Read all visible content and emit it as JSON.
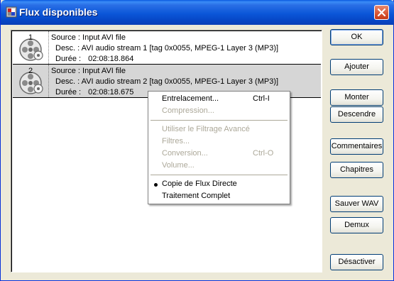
{
  "window": {
    "title": "Flux disponibles"
  },
  "streams": [
    {
      "number": "1",
      "source": "Source : Input AVI file",
      "desc": "Desc. : AVI audio stream 1 [tag 0x0055, MPEG-1 Layer 3 (MP3)]",
      "duration_label": "Durée :",
      "duration": "02:08:18.864",
      "selected": false
    },
    {
      "number": "2",
      "source": "Source : Input AVI file",
      "desc": "Desc. : AVI audio stream 2 [tag 0x0055, MPEG-1 Layer 3 (MP3)]",
      "duration_label": "Durée :",
      "duration": "02:08:18.675",
      "selected": true
    }
  ],
  "buttons": {
    "ok": "OK",
    "add": "Ajouter",
    "up": "Monter",
    "down": "Descendre",
    "comments": "Commentaires",
    "chapters": "Chapitres",
    "save_wav": "Sauver WAV",
    "demux": "Demux",
    "disable": "Désactiver"
  },
  "context_menu": {
    "interlace": {
      "label": "Entrelacement...",
      "shortcut": "Ctrl-I",
      "enabled": true
    },
    "compression": {
      "label": "Compression...",
      "enabled": false
    },
    "advanced_filtering": {
      "label": "Utiliser le Filtrage Avancé",
      "enabled": false
    },
    "filters": {
      "label": "Filtres...",
      "enabled": false
    },
    "conversion": {
      "label": "Conversion...",
      "shortcut": "Ctrl-O",
      "enabled": false
    },
    "volume": {
      "label": "Volume...",
      "enabled": false
    },
    "direct_copy": {
      "label": "Copie de Flux Directe",
      "enabled": true,
      "checked": true
    },
    "full_processing": {
      "label": "Traitement Complet",
      "enabled": true,
      "checked": false
    }
  },
  "icons": {
    "title": "app-icon",
    "close": "close-icon",
    "stream": "film-reel-icon",
    "radio": "radio-bullet-icon"
  },
  "colors": {
    "titlebar": "#0b56d8",
    "selected_row": "#d6d6d6",
    "disabled_text": "#aca899",
    "close_button": "#d85433"
  }
}
